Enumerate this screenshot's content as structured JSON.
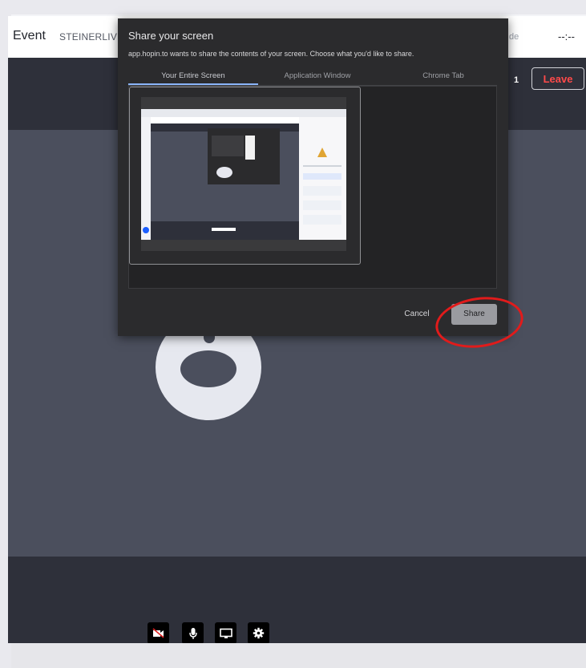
{
  "header": {
    "event_title": "Event",
    "event_name": "STEINERLIVE.",
    "right_label": "de",
    "timer": "--:--",
    "participant_count": "1",
    "leave_label": "Leave"
  },
  "dialog": {
    "title": "Share your screen",
    "subtitle": "app.hopin.to wants to share the contents of your screen. Choose what you'd like to share.",
    "tabs": [
      "Your Entire Screen",
      "Application Window",
      "Chrome Tab"
    ],
    "selected_tab": "Your Entire Screen",
    "cancel_label": "Cancel",
    "share_label": "Share"
  },
  "controls": [
    "camera-off-icon",
    "microphone-icon",
    "screen-share-icon",
    "settings-gear-icon"
  ],
  "colors": {
    "leave": "#ff4a4a",
    "highlight": "#e11b1b",
    "tab_indicator": "#8ab4f8",
    "stage": "#4b4f5d",
    "dialog": "#2b2b2d"
  }
}
